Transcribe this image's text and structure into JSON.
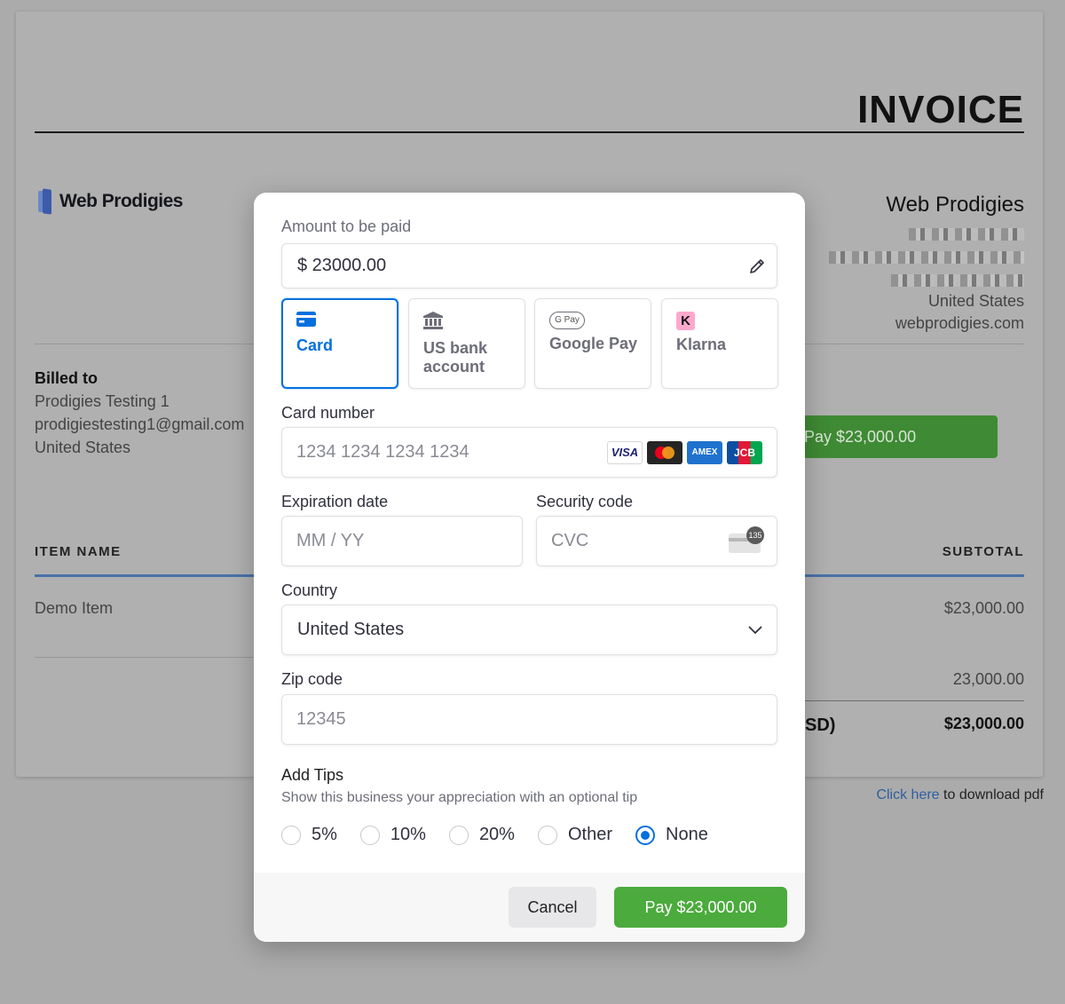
{
  "invoice": {
    "title": "INVOICE",
    "logo_text": "Web Prodigies",
    "seller": {
      "name": "Web Prodigies",
      "country": "United States",
      "website": "webprodigies.com"
    },
    "billed": {
      "heading": "Billed to",
      "name": "Prodigies Testing 1",
      "email": "prodigiestesting1@gmail.com",
      "country": "United States"
    },
    "pay_button": "Pay $23,000.00",
    "columns": {
      "item": "ITEM NAME",
      "subtotal": "SUBTOTAL"
    },
    "rows": [
      {
        "item": "Demo Item",
        "subtotal": "$23,000.00"
      }
    ],
    "summary": {
      "subtotal_value": "23,000.00",
      "total_label_fragment": "SD)",
      "total_value": "$23,000.00"
    },
    "download": {
      "link": "Click here",
      "rest": " to download pdf"
    }
  },
  "modal": {
    "amount_label": "Amount to be paid",
    "amount_value": "$ 23000.00",
    "methods": [
      {
        "label": "Card",
        "icon": "card-icon",
        "selected": true
      },
      {
        "label": "US bank account",
        "icon": "bank-icon",
        "selected": false
      },
      {
        "label": "Google Pay",
        "icon": "google-pay-icon",
        "selected": false
      },
      {
        "label": "Klarna",
        "icon": "klarna-icon",
        "selected": false
      }
    ],
    "gpay_badge": "G Pay",
    "klarna_badge": "K",
    "card_number_label": "Card number",
    "card_number_placeholder": "1234 1234 1234 1234",
    "brands": {
      "visa": "VISA",
      "amex": "AMEX",
      "jcb": "JCB"
    },
    "expiry_label": "Expiration date",
    "expiry_placeholder": "MM / YY",
    "security_label": "Security code",
    "security_placeholder": "CVC",
    "cvc_badge": "135",
    "country_label": "Country",
    "country_value": "United States",
    "zip_label": "Zip code",
    "zip_placeholder": "12345",
    "tips_heading": "Add Tips",
    "tips_sub": "Show this business your appreciation with an optional tip",
    "tips": [
      {
        "label": "5%",
        "selected": false
      },
      {
        "label": "10%",
        "selected": false
      },
      {
        "label": "20%",
        "selected": false
      },
      {
        "label": "Other",
        "selected": false
      },
      {
        "label": "None",
        "selected": true
      }
    ],
    "cancel_label": "Cancel",
    "pay_label": "Pay $23,000.00"
  },
  "colors": {
    "accent": "#0570de",
    "pay_green": "#4bab3d",
    "overlay": "#ababab"
  }
}
